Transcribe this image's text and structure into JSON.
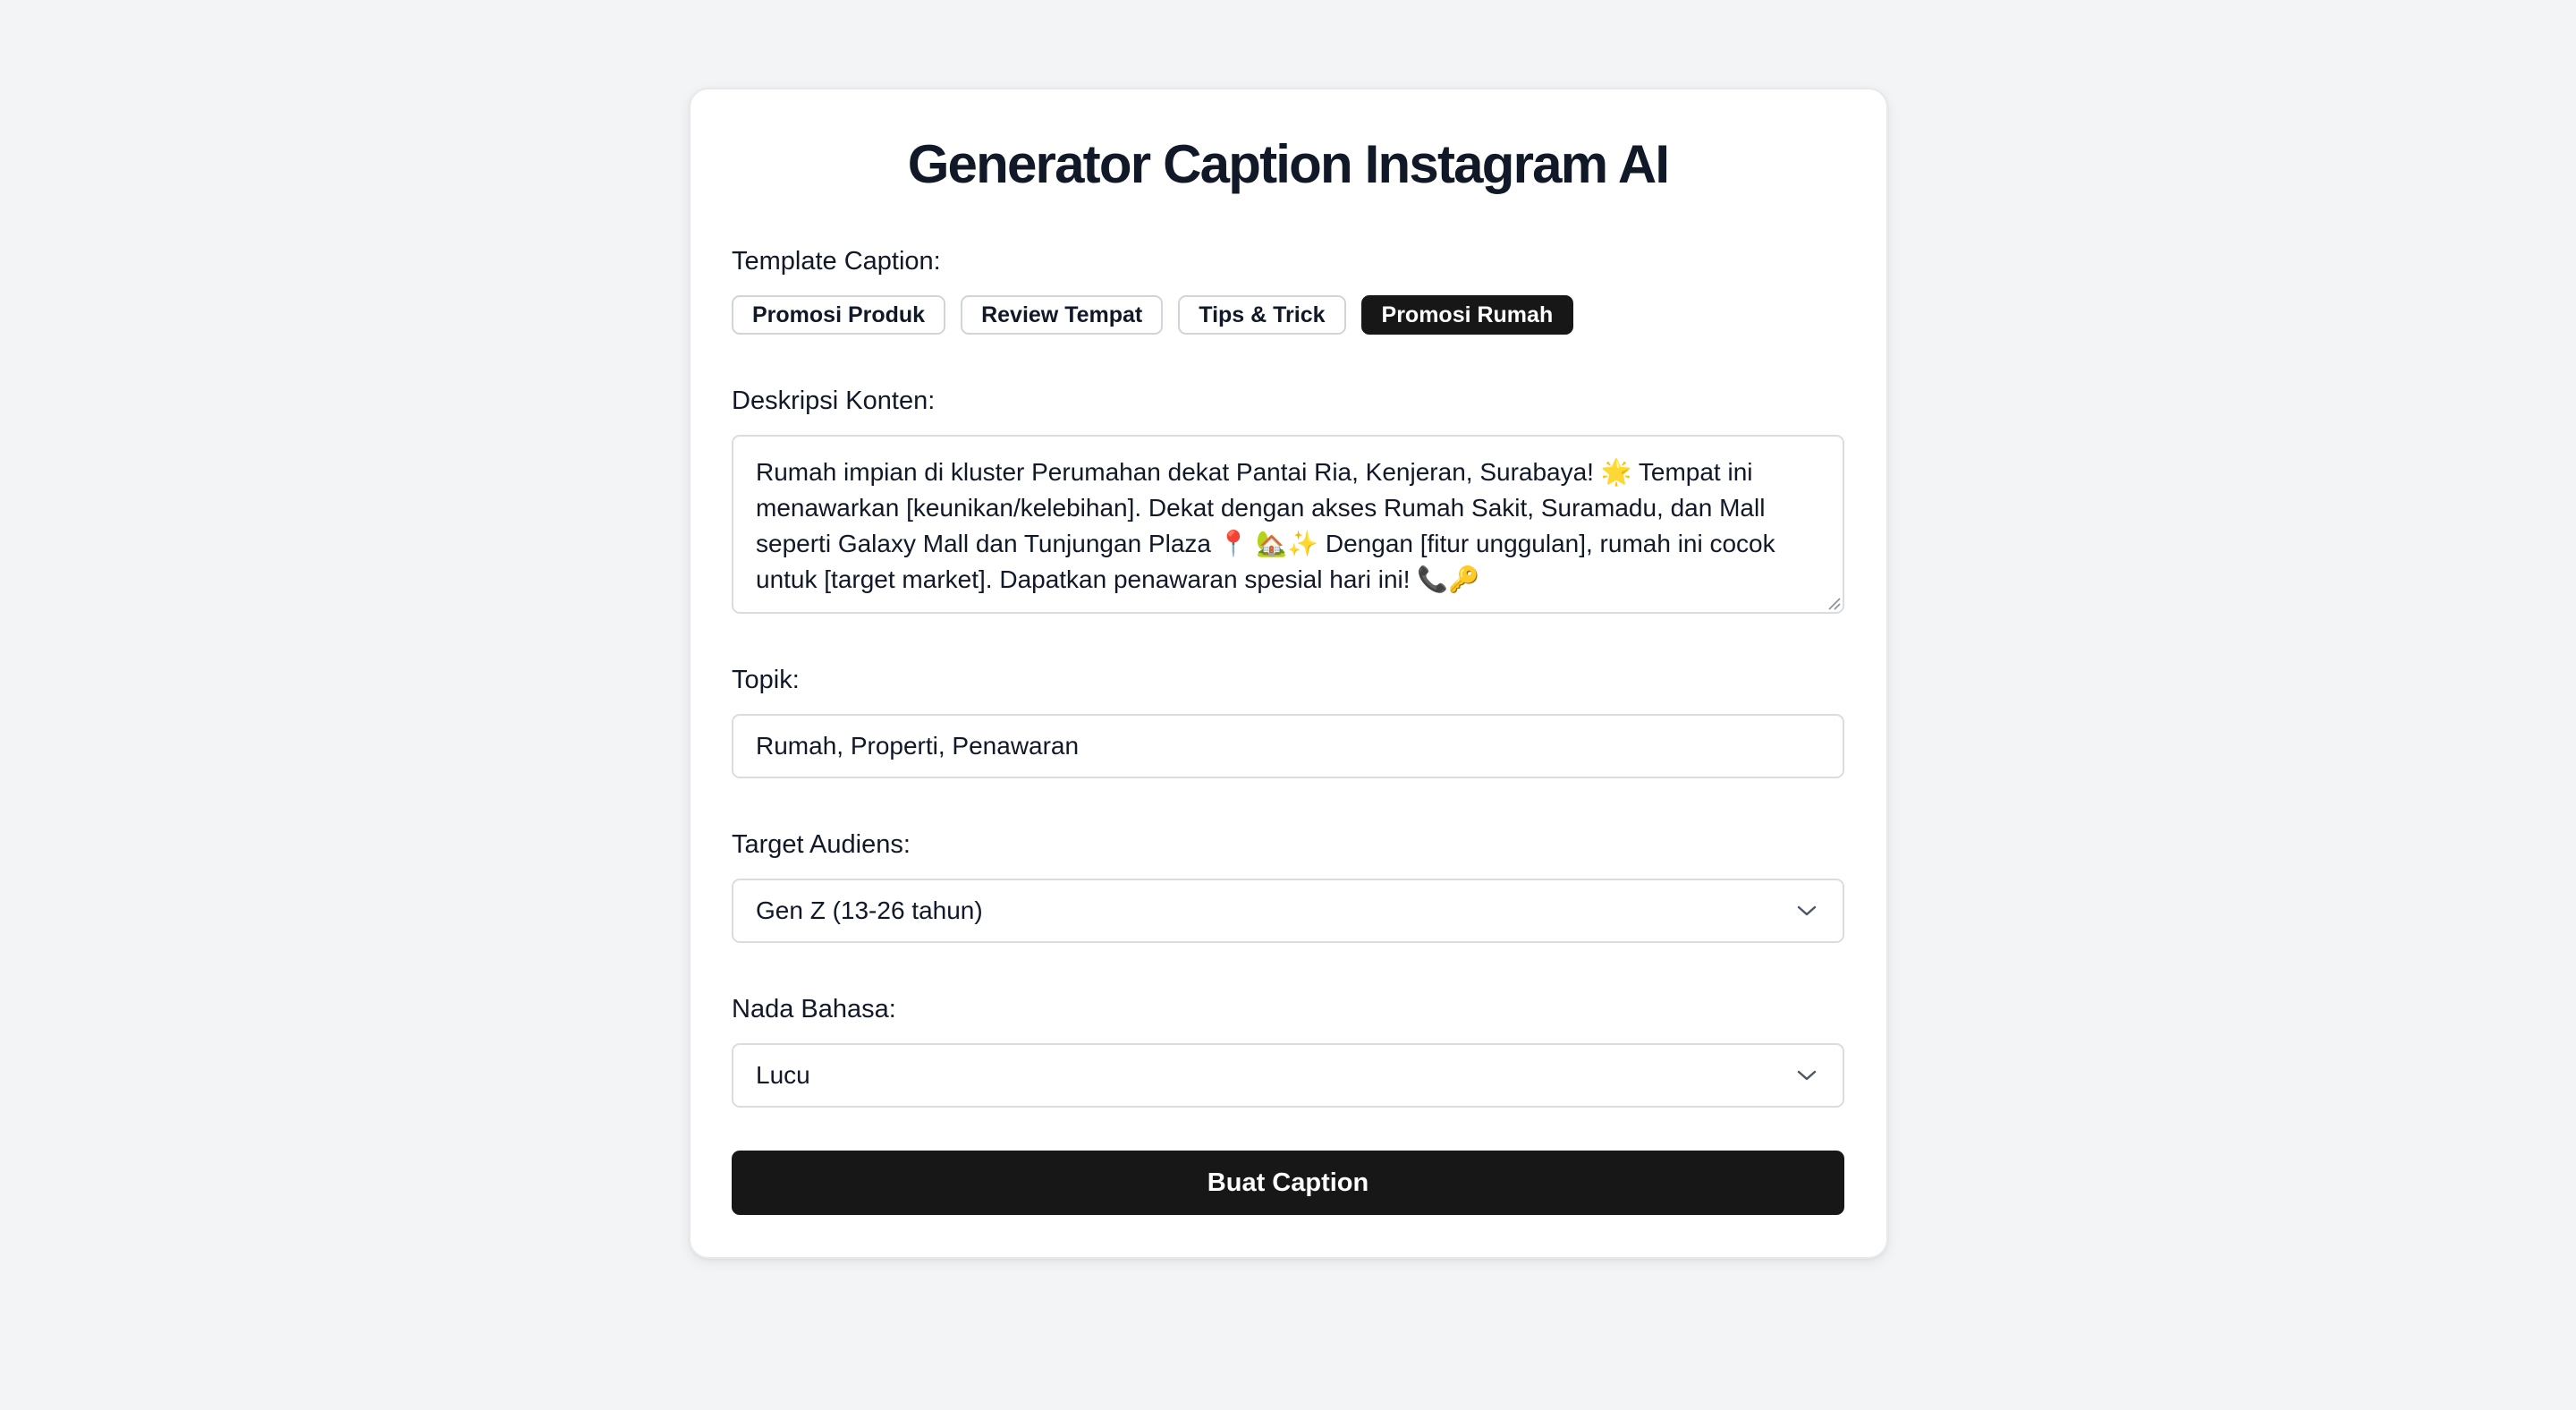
{
  "title": "Generator Caption Instagram AI",
  "template": {
    "label": "Template Caption:",
    "options": [
      {
        "label": "Promosi Produk",
        "active": false
      },
      {
        "label": "Review Tempat",
        "active": false
      },
      {
        "label": "Tips & Trick",
        "active": false
      },
      {
        "label": "Promosi Rumah",
        "active": true
      }
    ]
  },
  "description": {
    "label": "Deskripsi Konten:",
    "value": "Rumah impian di kluster Perumahan dekat Pantai Ria, Kenjeran, Surabaya! 🌟 Tempat ini menawarkan [keunikan/kelebihan]. Dekat dengan akses Rumah Sakit, Suramadu, dan Mall seperti Galaxy Mall dan Tunjungan Plaza 📍 🏡✨ Dengan [fitur unggulan], rumah ini cocok untuk [target market]. Dapatkan penawaran spesial hari ini! 📞🔑"
  },
  "topic": {
    "label": "Topik:",
    "value": "Rumah, Properti, Penawaran"
  },
  "audience": {
    "label": "Target Audiens:",
    "selected": "Gen Z (13-26 tahun)"
  },
  "tone": {
    "label": "Nada Bahasa:",
    "selected": "Lucu"
  },
  "submit_label": "Buat Caption",
  "colors": {
    "background": "#f3f4f6",
    "primary": "#171717",
    "text": "#111827",
    "border": "#d9dce1"
  },
  "icons": {
    "select_chevron": "chevron-down-icon",
    "textarea_resize": "resize-grip-icon"
  }
}
